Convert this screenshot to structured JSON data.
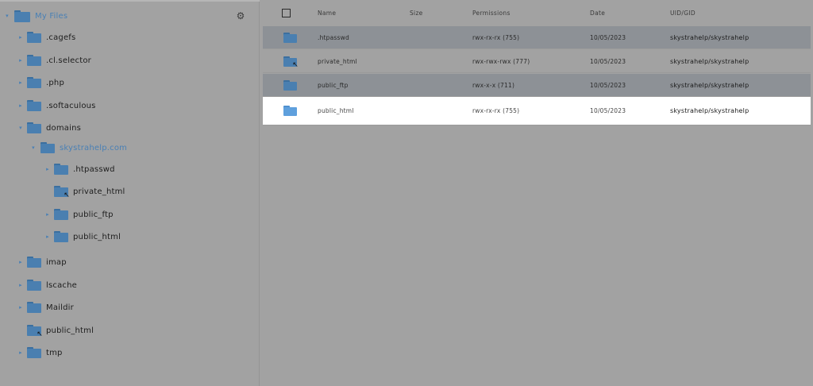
{
  "sidebar": {
    "root": {
      "label": "My Files",
      "arrow": "▾",
      "icon": "folder-icon"
    },
    "settings_icon": "gear-icon",
    "items": [
      {
        "label": ".cagefs",
        "arrow": "▸",
        "icon": "folder-icon"
      },
      {
        "label": ".cl.selector",
        "arrow": "▸",
        "icon": "folder-icon"
      },
      {
        "label": ".php",
        "arrow": "▸",
        "icon": "folder-icon"
      },
      {
        "label": ".softaculous",
        "arrow": "▸",
        "icon": "folder-icon"
      },
      {
        "label": "domains",
        "arrow": "▾",
        "icon": "folder-icon"
      },
      {
        "label": "skystrahelp.com",
        "arrow": "▾",
        "icon": "folder-icon"
      },
      {
        "label": ".htpasswd",
        "arrow": "▸",
        "icon": "folder-icon"
      },
      {
        "label": "private_html",
        "arrow": "",
        "icon": "folder-link-icon"
      },
      {
        "label": "public_ftp",
        "arrow": "▸",
        "icon": "folder-icon"
      },
      {
        "label": "public_html",
        "arrow": "▸",
        "icon": "folder-icon"
      },
      {
        "label": "imap",
        "arrow": "▸",
        "icon": "folder-icon"
      },
      {
        "label": "lscache",
        "arrow": "▸",
        "icon": "folder-icon"
      },
      {
        "label": "Maildir",
        "arrow": "▸",
        "icon": "folder-icon"
      },
      {
        "label": "public_html",
        "arrow": "",
        "icon": "folder-link-icon"
      },
      {
        "label": "tmp",
        "arrow": "▸",
        "icon": "folder-icon"
      }
    ]
  },
  "table": {
    "headers": {
      "name": "Name",
      "size": "Size",
      "permissions": "Permissions",
      "date": "Date",
      "owner": "UID/GID"
    },
    "rows": [
      {
        "name": ".htpasswd",
        "size": "",
        "permissions": "rwx-rx-rx (755)",
        "date": "10/05/2023",
        "owner": "skystrahelp/skystrahelp",
        "icon": "folder-icon"
      },
      {
        "name": "private_html",
        "size": "",
        "permissions": "rwx-rwx-rwx (777)",
        "date": "10/05/2023",
        "owner": "skystrahelp/skystrahelp",
        "icon": "folder-link-icon"
      },
      {
        "name": "public_ftp",
        "size": "",
        "permissions": "rwx-x-x (711)",
        "date": "10/05/2023",
        "owner": "skystrahelp/skystrahelp",
        "icon": "folder-icon"
      },
      {
        "name": "public_html",
        "size": "",
        "permissions": "rwx-rx-rx (755)",
        "date": "10/05/2023",
        "owner": "skystrahelp/skystrahelp",
        "icon": "folder-icon"
      }
    ]
  },
  "colors": {
    "overlay": "#a2a2a2",
    "accent": "#4a80b5",
    "row_highlight": "#8d9196",
    "selected_row": "#ffffff"
  }
}
